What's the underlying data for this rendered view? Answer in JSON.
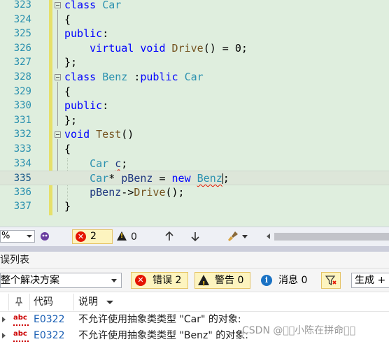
{
  "editor": {
    "lines": [
      {
        "num": "323",
        "tokens": [
          [
            "kw",
            "class"
          ],
          [
            "",
            " "
          ],
          [
            "ty",
            "Car"
          ]
        ],
        "fold": true
      },
      {
        "num": "324",
        "tokens": [
          [
            "",
            "{"
          ]
        ]
      },
      {
        "num": "325",
        "tokens": [
          [
            "kw",
            "public"
          ],
          [
            "",
            ":"
          ]
        ]
      },
      {
        "num": "326",
        "tokens": [
          [
            "",
            "    "
          ],
          [
            "kw",
            "virtual"
          ],
          [
            "",
            " "
          ],
          [
            "kw",
            "void"
          ],
          [
            "",
            " "
          ],
          [
            "fn",
            "Drive"
          ],
          [
            "",
            "() = 0;"
          ]
        ]
      },
      {
        "num": "327",
        "tokens": [
          [
            "",
            "};"
          ]
        ]
      },
      {
        "num": "328",
        "tokens": [
          [
            "kw",
            "class"
          ],
          [
            "",
            " "
          ],
          [
            "ty",
            "Benz"
          ],
          [
            "",
            " :"
          ],
          [
            "kw",
            "public"
          ],
          [
            "",
            " "
          ],
          [
            "ty",
            "Car"
          ]
        ],
        "fold": true
      },
      {
        "num": "329",
        "tokens": [
          [
            "",
            "{"
          ]
        ]
      },
      {
        "num": "330",
        "tokens": [
          [
            "kw",
            "public"
          ],
          [
            "",
            ":"
          ]
        ]
      },
      {
        "num": "331",
        "tokens": [
          [
            "",
            "};"
          ]
        ]
      },
      {
        "num": "332",
        "tokens": [
          [
            "kw",
            "void"
          ],
          [
            "",
            " "
          ],
          [
            "fn",
            "Test"
          ],
          [
            "",
            "()"
          ]
        ],
        "fold": true
      },
      {
        "num": "333",
        "tokens": [
          [
            "",
            "{"
          ]
        ]
      },
      {
        "num": "334",
        "tokens": [
          [
            "",
            "    "
          ],
          [
            "ty",
            "Car"
          ],
          [
            "",
            " "
          ],
          [
            "vaS",
            "c"
          ],
          [
            "",
            ";"
          ]
        ]
      },
      {
        "num": "335",
        "tokens": [
          [
            "",
            "    "
          ],
          [
            "ty",
            "Car"
          ],
          [
            "",
            "* "
          ],
          [
            "va",
            "pBenz"
          ],
          [
            "",
            " = "
          ],
          [
            "kw",
            "new"
          ],
          [
            "",
            " "
          ],
          [
            "tyS",
            "Benz"
          ],
          [
            "caret",
            ""
          ],
          [
            "",
            ";"
          ]
        ],
        "current": true
      },
      {
        "num": "336",
        "tokens": [
          [
            "",
            "    "
          ],
          [
            "va",
            "pBenz"
          ],
          [
            "",
            "->"
          ],
          [
            "fn",
            "Drive"
          ],
          [
            "",
            "();"
          ]
        ]
      },
      {
        "num": "337",
        "tokens": [
          [
            "",
            "}"
          ]
        ]
      }
    ]
  },
  "status_strip": {
    "zoom": "%",
    "errors": "2",
    "warnings": "0"
  },
  "error_list": {
    "title": "误列表",
    "scope": "整个解决方案",
    "errors_btn": "错误 2",
    "warnings_btn": "警告 0",
    "messages_btn": "消息 0",
    "build_select": "生成 +",
    "col_code": "代码",
    "col_desc": "说明",
    "rows": [
      {
        "code": "E0322",
        "desc": "不允许使用抽象类类型 \"Car\" 的对象:"
      },
      {
        "code": "E0322",
        "desc": "不允许使用抽象类类型 \"Benz\" 的对象:"
      }
    ]
  },
  "watermark": "CSDN @\u0000\u0000小陈在拼命\u0000\u0000",
  "colors": {
    "editor_bg": "#dfeede",
    "keyword": "#0000ff",
    "type": "#2b91af",
    "error_red": "#e51400"
  }
}
